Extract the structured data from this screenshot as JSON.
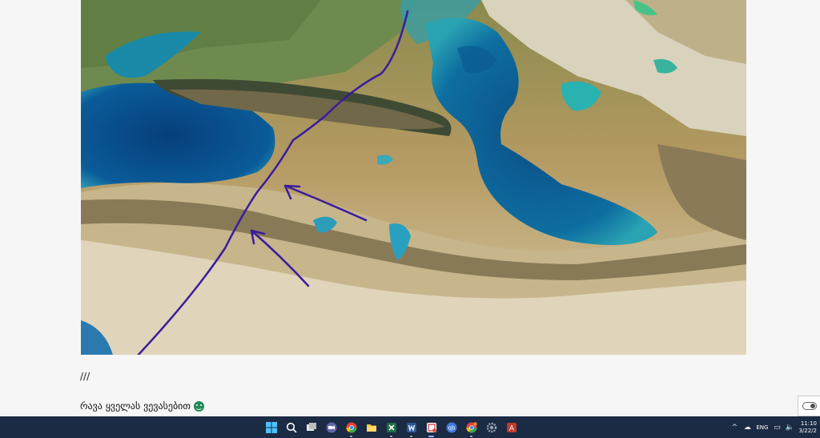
{
  "post": {
    "separator": "///",
    "caption": "რავა ყველას ვევასებით"
  },
  "taskbar": {
    "apps": [
      {
        "name": "Start",
        "icon": "windows-start-icon",
        "color": "#4cc2ff"
      },
      {
        "name": "Search",
        "icon": "search-icon",
        "color": "#ffffff"
      },
      {
        "name": "Task View",
        "icon": "task-view-icon",
        "color": "#dddddd"
      },
      {
        "name": "Meet",
        "icon": "video-call-icon",
        "color": "#6264a7"
      },
      {
        "name": "Chrome",
        "icon": "chrome-icon",
        "color": "#ea4335"
      },
      {
        "name": "File Explorer",
        "icon": "folder-icon",
        "color": "#f4c542"
      },
      {
        "name": "Excel",
        "icon": "excel-icon",
        "color": "#1d7044"
      },
      {
        "name": "Word",
        "icon": "word-icon",
        "color": "#2b5797"
      },
      {
        "name": "Snipping Tool",
        "icon": "snip-icon",
        "color": "#e23d3d"
      },
      {
        "name": "qBittorrent",
        "icon": "qbittorrent-icon",
        "color": "#3d7bd9"
      },
      {
        "name": "Chrome Profile",
        "icon": "chrome-icon",
        "color": "#fbbc05"
      },
      {
        "name": "Settings",
        "icon": "gear-icon",
        "color": "#9aa7b8"
      },
      {
        "name": "Access",
        "icon": "access-icon",
        "color": "#c0392b"
      }
    ],
    "tray": {
      "chevron": "^",
      "language": "ENG",
      "time": "11:10",
      "date": "3/22/2"
    }
  }
}
